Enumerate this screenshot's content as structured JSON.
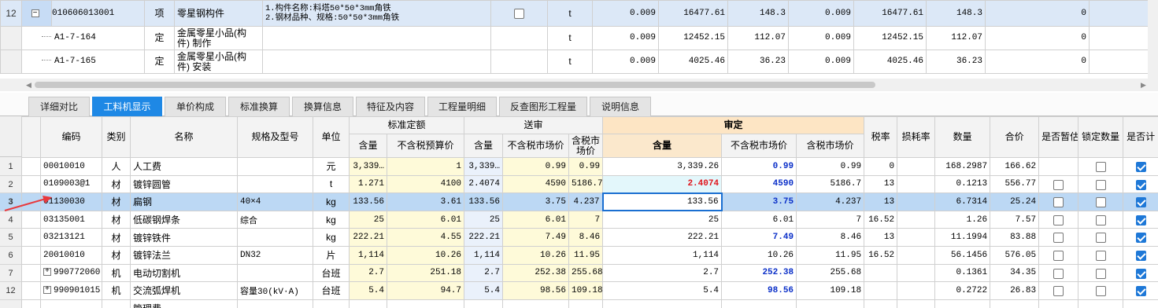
{
  "top_table": {
    "rows": [
      {
        "num": "12",
        "code": "010606013001",
        "type": "项",
        "name": "零星钢构件",
        "feature_line1": "1.构件名称:料塔50*50*3mm角铁",
        "feature_line2": "2.钢材品种、规格:50*50*3mm角铁",
        "unit": "t",
        "qty": "0.009",
        "price": "16477.61",
        "total": "148.3",
        "qty2": "0.009",
        "price2": "16477.61",
        "total2": "148.3",
        "last": "0"
      },
      {
        "num": "",
        "code": "A1-7-164",
        "type": "定",
        "name_line1": "金属零星小品(构",
        "name_line2": "件) 制作",
        "unit": "t",
        "qty": "0.009",
        "price": "12452.15",
        "total": "112.07",
        "qty2": "0.009",
        "price2": "12452.15",
        "total2": "112.07",
        "last": "0"
      },
      {
        "num": "",
        "code": "A1-7-165",
        "type": "定",
        "name_line1": "金属零星小品(构",
        "name_line2": "件) 安装",
        "unit": "t",
        "qty": "0.009",
        "price": "4025.46",
        "total": "36.23",
        "qty2": "0.009",
        "price2": "4025.46",
        "total2": "36.23",
        "last": "0"
      }
    ]
  },
  "tabs": [
    "详细对比",
    "工料机显示",
    "单价构成",
    "标准换算",
    "换算信息",
    "特征及内容",
    "工程量明细",
    "反查图形工程量",
    "说明信息"
  ],
  "active_tab": "工料机显示",
  "grid": {
    "headers": {
      "code": "编码",
      "category": "类别",
      "name": "名称",
      "spec": "规格及型号",
      "unit": "单位",
      "std_group": "标准定额",
      "sent_group": "送审",
      "audit_group": "审定",
      "qty": "含量",
      "price_excl": "不含税预算价",
      "mkt_excl": "不含税市场价",
      "mkt_incl_l1": "含税市",
      "mkt_incl_l2": "场价",
      "mkt_excl2": "不含税市场价",
      "mkt_incl2": "含税市场价",
      "tax": "税率",
      "loss": "损耗率",
      "count": "数量",
      "sum": "合价",
      "provisional": "是否暂估",
      "lock": "锁定数量",
      "is_calc": "是否计"
    },
    "rows": [
      {
        "rn": "1",
        "code": "00010010",
        "cat": "人",
        "name": "人工费",
        "spec": "",
        "unit": "元",
        "q1": "3,339…",
        "p1": "1",
        "q2": "3,339…",
        "p2": "0.99",
        "p3": "0.99",
        "q3": "3,339.26",
        "p4": "0.99",
        "p5": "0.99",
        "tax": "0",
        "loss": "",
        "count": "168.2987",
        "sum": "166.62",
        "prov": "",
        "lock": "off",
        "calc": "on"
      },
      {
        "rn": "2",
        "code": "0109003@1",
        "cat": "材",
        "name": "镀锌圆管",
        "spec": "",
        "unit": "t",
        "q1": "1.271",
        "p1": "4100",
        "q2": "2.4074",
        "p2": "4590",
        "p3": "5186.7",
        "q3": "2.4074",
        "p4": "4590",
        "p5": "5186.7",
        "tax": "13",
        "loss": "",
        "count": "0.1213",
        "sum": "556.77",
        "prov": "off",
        "lock": "off",
        "calc": "on"
      },
      {
        "rn": "3",
        "code": "01130030",
        "cat": "材",
        "name": "扁钢",
        "spec": "40×4",
        "unit": "kg",
        "q1": "133.56",
        "p1": "3.61",
        "q2": "133.56",
        "p2": "3.75",
        "p3": "4.237",
        "q3": "133.56",
        "p4": "3.75",
        "p5": "4.237",
        "tax": "13",
        "loss": "",
        "count": "6.7314",
        "sum": "25.24",
        "prov": "off",
        "lock": "off",
        "calc": "on"
      },
      {
        "rn": "4",
        "code": "03135001",
        "cat": "材",
        "name": "低碳钢焊条",
        "spec": "综合",
        "unit": "kg",
        "q1": "25",
        "p1": "6.01",
        "q2": "25",
        "p2": "6.01",
        "p3": "7",
        "q3": "25",
        "p4": "6.01",
        "p5": "7",
        "tax": "16.52",
        "loss": "",
        "count": "1.26",
        "sum": "7.57",
        "prov": "off",
        "lock": "off",
        "calc": "on"
      },
      {
        "rn": "5",
        "code": "03213121",
        "cat": "材",
        "name": "镀锌铁件",
        "spec": "",
        "unit": "kg",
        "q1": "222.21",
        "p1": "4.55",
        "q2": "222.21",
        "p2": "7.49",
        "p3": "8.46",
        "q3": "222.21",
        "p4": "7.49",
        "p5": "8.46",
        "tax": "13",
        "loss": "",
        "count": "11.1994",
        "sum": "83.88",
        "prov": "off",
        "lock": "off",
        "calc": "on"
      },
      {
        "rn": "6",
        "code": "20010010",
        "cat": "材",
        "name": "镀锌法兰",
        "spec": "DN32",
        "unit": "片",
        "q1": "1,114",
        "p1": "10.26",
        "q2": "1,114",
        "p2": "10.26",
        "p3": "11.95",
        "q3": "1,114",
        "p4": "10.26",
        "p5": "11.95",
        "tax": "16.52",
        "loss": "",
        "count": "56.1456",
        "sum": "576.05",
        "prov": "off",
        "lock": "off",
        "calc": "on"
      },
      {
        "rn": "7",
        "code": "990772060",
        "cat": "机",
        "name": "电动切割机",
        "spec": "",
        "unit": "台班",
        "q1": "2.7",
        "p1": "251.18",
        "q2": "2.7",
        "p2": "252.38",
        "p3": "255.68",
        "q3": "2.7",
        "p4": "252.38",
        "p5": "255.68",
        "tax": "",
        "loss": "",
        "count": "0.1361",
        "sum": "34.35",
        "prov": "off",
        "lock": "off",
        "calc": "on"
      },
      {
        "rn": "12",
        "code": "990901015",
        "cat": "机",
        "name": "交流弧焊机",
        "spec": "容量30(kV·A)",
        "unit": "台班",
        "q1": "5.4",
        "p1": "94.7",
        "q2": "5.4",
        "p2": "98.56",
        "p3": "109.18",
        "q3": "5.4",
        "p4": "98.56",
        "p5": "109.18",
        "tax": "",
        "loss": "",
        "count": "0.2722",
        "sum": "26.83",
        "prov": "off",
        "lock": "off",
        "calc": "on"
      }
    ],
    "partial_row": {
      "code": "…",
      "cat": "",
      "name": "管理费"
    }
  }
}
